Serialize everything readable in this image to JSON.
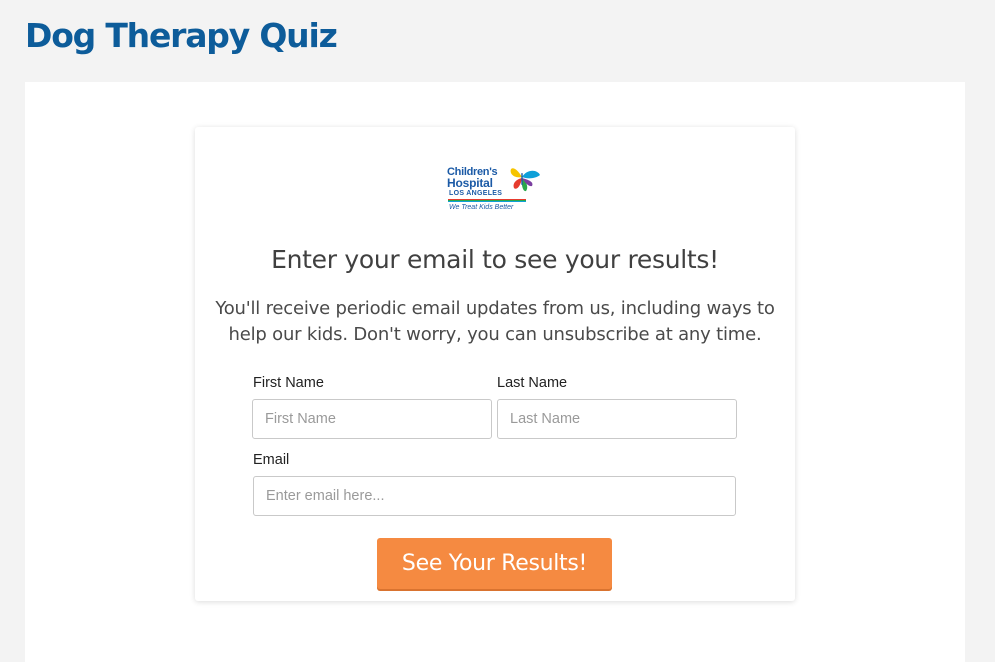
{
  "page": {
    "title": "Dog Therapy Quiz"
  },
  "logo": {
    "line1": "Children's",
    "line2": "Hospital",
    "line3": "LOS ANGELES",
    "tagline": "We Treat Kids Better",
    "colors": [
      "#1b5aa6",
      "#e63b2e",
      "#f6c400",
      "#2aa84a",
      "#0ea0d8",
      "#7b3fa0"
    ]
  },
  "form": {
    "heading": "Enter your email to see your results!",
    "description": "You'll receive periodic email updates from us, including ways to help our kids. Don't worry, you can unsubscribe at any time.",
    "first_name": {
      "label": "First Name",
      "placeholder": "First Name",
      "value": ""
    },
    "last_name": {
      "label": "Last Name",
      "placeholder": "Last Name",
      "value": ""
    },
    "email": {
      "label": "Email",
      "placeholder": "Enter email here...",
      "value": ""
    },
    "submit_label": "See Your Results!"
  },
  "colors": {
    "title": "#0d5c9a",
    "button": "#f58a41",
    "background": "#f3f3f3"
  }
}
